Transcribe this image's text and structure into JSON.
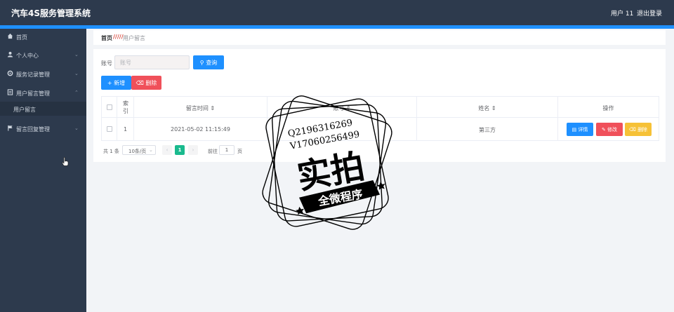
{
  "header": {
    "app_title": "汽车4S服务管理系统",
    "user": "用户 11",
    "logout": "退出登录"
  },
  "sidebar": {
    "items": [
      {
        "label": "首页",
        "icon": "home-icon",
        "chevron": false
      },
      {
        "label": "个人中心",
        "icon": "user-icon",
        "chevron": true
      },
      {
        "label": "服务记录管理",
        "icon": "settings-icon",
        "chevron": true
      },
      {
        "label": "用户留言管理",
        "icon": "document-icon",
        "chevron": true,
        "expanded": true
      },
      {
        "label": "留言回复管理",
        "icon": "flag-icon",
        "chevron": true
      }
    ],
    "submenu": [
      {
        "label": "用户留言",
        "active": true
      }
    ]
  },
  "breadcrumb": {
    "home": "首页",
    "separator": "/////",
    "current": "用户留言"
  },
  "search": {
    "label": "账号",
    "placeholder": "账号",
    "query_button": "查询"
  },
  "actions": {
    "add": "新增",
    "delete": "删除"
  },
  "table": {
    "columns": [
      "索引",
      "留言时间",
      "账号",
      "姓名",
      "操作"
    ],
    "rows": [
      {
        "index": "1",
        "time": "2021-05-02 11:15:49",
        "account": "",
        "name": "第三方"
      }
    ],
    "ops": {
      "detail": "详情",
      "edit": "修改",
      "delete": "删除"
    }
  },
  "pagination": {
    "total": "共 1 条",
    "page_size": "10条/页",
    "current_page": "1",
    "goto_label": "前往",
    "goto_value": "1",
    "page_unit": "页"
  },
  "watermark": {
    "line1": "Q2196316269",
    "line2": "V17060256499",
    "big": "实拍",
    "banner": "全微程序"
  },
  "colors": {
    "primary": "#1e90ff",
    "danger": "#f0505a",
    "warning": "#f6c136",
    "success": "#1aba8e",
    "sidebar": "#2d3a4d"
  }
}
